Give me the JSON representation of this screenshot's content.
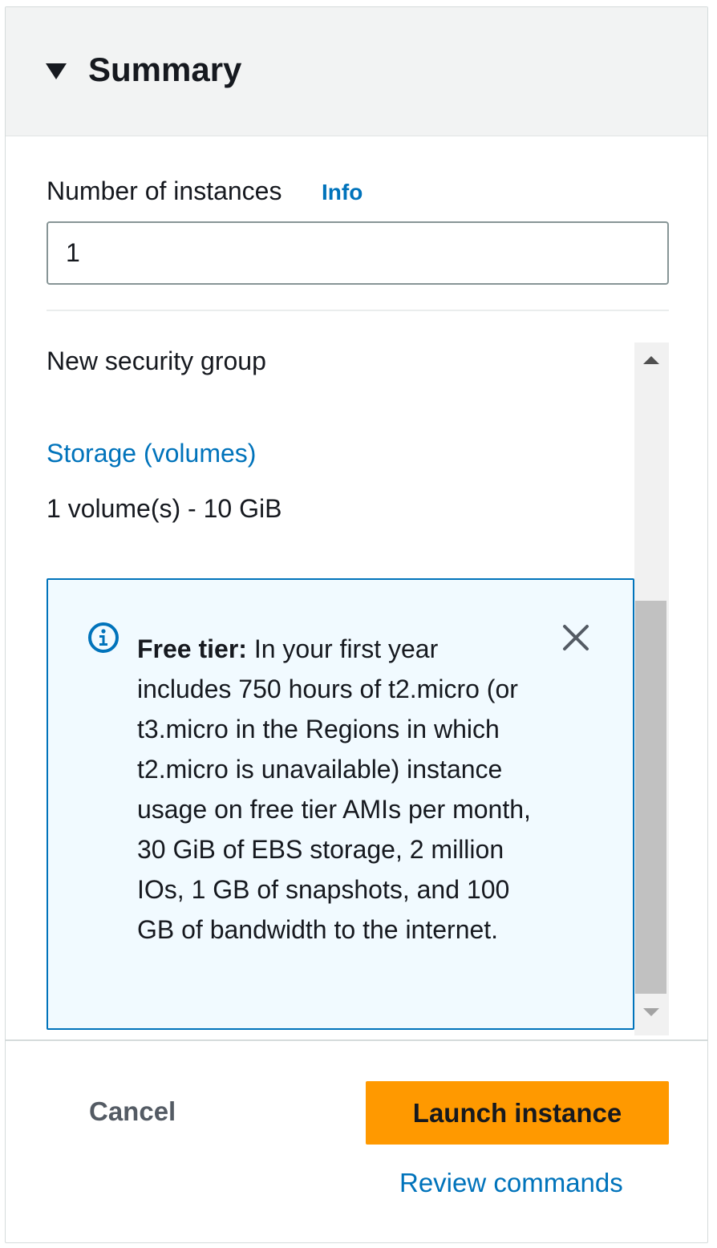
{
  "summary": {
    "title": "Summary"
  },
  "instances": {
    "label": "Number of instances",
    "info_link": "Info",
    "value": "1"
  },
  "details": {
    "security_group": "New security group",
    "storage_link": "Storage (volumes)",
    "volume_text": "1 volume(s) - 10 GiB"
  },
  "alert": {
    "bold_label": "Free tier:",
    "message": " In your first year includes 750 hours of t2.micro (or t3.micro in the Regions in which t2.micro is unavailable) instance usage on free tier AMIs per month, 30 GiB of EBS storage, 2 million IOs, 1 GB of snapshots, and 100 GB of bandwidth to the internet."
  },
  "footer": {
    "cancel_label": "Cancel",
    "launch_label": "Launch instance",
    "review_label": "Review commands"
  },
  "icons": {
    "header": "caret-down-icon",
    "alert": "info-circle-icon",
    "dismiss": "close-icon"
  },
  "colors": {
    "link": "#0073bb",
    "primary_button": "#ff9900",
    "alert_background": "#f1faff",
    "text": "#16191f"
  }
}
